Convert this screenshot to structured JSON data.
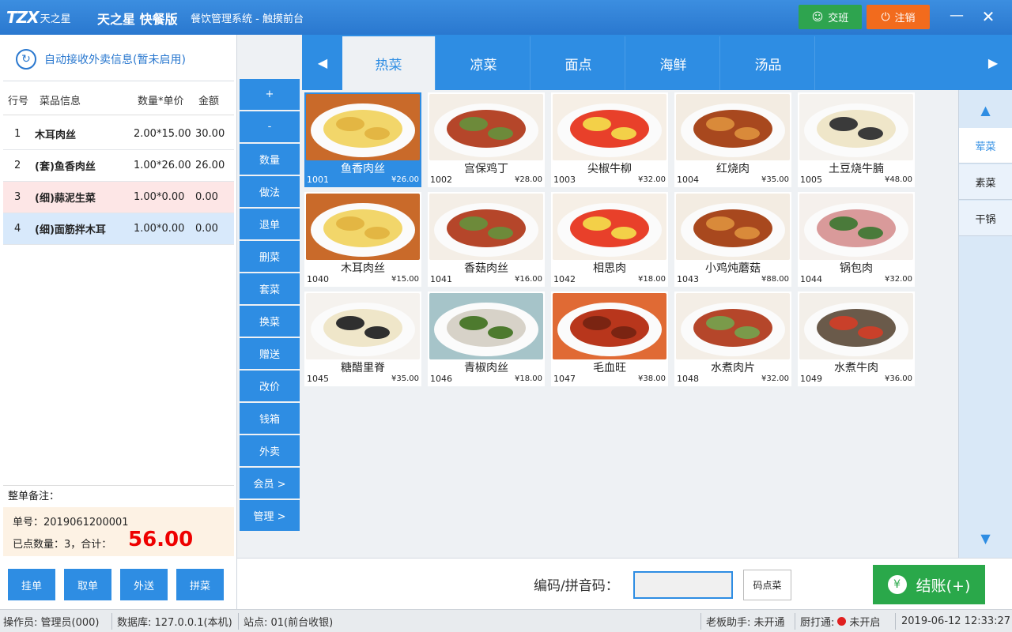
{
  "titlebar": {
    "logo_mark": "TZX",
    "logo_text": "天之星",
    "app_name": "天之星 快餐版",
    "subtitle": "餐饮管理系统 - 触摸前台",
    "shift_label": "交班",
    "logout_label": "注销",
    "minimize": "—",
    "close": "✕"
  },
  "left": {
    "auto_recv": "自动接收外卖信息(暂未启用)",
    "headers": {
      "no": "行号",
      "info": "菜品信息",
      "qty_price": "数量*单价",
      "amount": "金额"
    },
    "rows": [
      {
        "no": "1",
        "name": "木耳肉丝",
        "qty_price": "2.00*15.00",
        "amount": "30.00",
        "bg": "#ffffff"
      },
      {
        "no": "2",
        "name": "(套)鱼香肉丝",
        "qty_price": "1.00*26.00",
        "amount": "26.00",
        "bg": "#ffffff"
      },
      {
        "no": "3",
        "name": "(细)蒜泥生菜",
        "qty_price": "1.00*0.00",
        "amount": "0.00",
        "bg": "#fde6e6"
      },
      {
        "no": "4",
        "name": "(细)面筋拌木耳",
        "qty_price": "1.00*0.00",
        "amount": "0.00",
        "bg": "#d8e9fb"
      }
    ],
    "remark_label": "整单备注：",
    "order_no": "单号：2019061200001",
    "count_line": "已点数量：3，合计：",
    "total": "56.00",
    "buttons": [
      "挂单",
      "取单",
      "外送",
      "拼菜"
    ]
  },
  "actions": [
    "+",
    "-",
    "数量",
    "做法",
    "退单",
    "删菜",
    "套菜",
    "换菜",
    "赠送",
    "改价",
    "钱箱",
    "外卖",
    "会员 >",
    "管理 >"
  ],
  "tabs": [
    "热菜",
    "凉菜",
    "面点",
    "海鲜",
    "汤品"
  ],
  "tab_arrows": {
    "left": "◀",
    "right": "▶"
  },
  "dishes": [
    {
      "name": "鱼香肉丝",
      "code": "1001",
      "price": "¥26.00",
      "selected": true,
      "colors": [
        "#f2d66a",
        "#e3b643",
        "#c96a2a"
      ]
    },
    {
      "name": "宫保鸡丁",
      "code": "1002",
      "price": "¥28.00",
      "selected": false,
      "colors": [
        "#b5462a",
        "#6d8a3a",
        "#f4eee6"
      ]
    },
    {
      "name": "尖椒牛柳",
      "code": "1003",
      "price": "¥32.00",
      "selected": false,
      "colors": [
        "#e8402a",
        "#f3d048",
        "#f6efe6"
      ]
    },
    {
      "name": "红烧肉",
      "code": "1004",
      "price": "¥35.00",
      "selected": false,
      "colors": [
        "#a8481e",
        "#d98a3a",
        "#f3ece2"
      ]
    },
    {
      "name": "土豆烧牛腩",
      "code": "1005",
      "price": "¥48.00",
      "selected": false,
      "colors": [
        "#efe6c9",
        "#3a3a3a",
        "#f5f2ee"
      ]
    },
    {
      "name": "木耳肉丝",
      "code": "1040",
      "price": "¥15.00",
      "selected": false,
      "colors": [
        "#f2d66a",
        "#e3b643",
        "#c96a2a"
      ]
    },
    {
      "name": "香菇肉丝",
      "code": "1041",
      "price": "¥16.00",
      "selected": false,
      "colors": [
        "#b5462a",
        "#6d8a3a",
        "#f4eee6"
      ]
    },
    {
      "name": "相思肉",
      "code": "1042",
      "price": "¥18.00",
      "selected": false,
      "colors": [
        "#e8402a",
        "#f3d048",
        "#f6efe6"
      ]
    },
    {
      "name": "小鸡炖蘑菇",
      "code": "1043",
      "price": "¥88.00",
      "selected": false,
      "colors": [
        "#a8481e",
        "#d98a3a",
        "#f3ece2"
      ]
    },
    {
      "name": "锅包肉",
      "code": "1044",
      "price": "¥32.00",
      "selected": false,
      "colors": [
        "#d99a9a",
        "#4a7a3a",
        "#f5f0ec"
      ]
    },
    {
      "name": "糖醋里脊",
      "code": "1045",
      "price": "¥35.00",
      "selected": false,
      "colors": [
        "#efe6c9",
        "#2f2f2f",
        "#f5f2ee"
      ]
    },
    {
      "name": "青椒肉丝",
      "code": "1046",
      "price": "¥18.00",
      "selected": false,
      "colors": [
        "#d7d2c8",
        "#4d7a2e",
        "#a6c4c9"
      ]
    },
    {
      "name": "毛血旺",
      "code": "1047",
      "price": "¥38.00",
      "selected": false,
      "colors": [
        "#b8361c",
        "#7a2412",
        "#e06a34"
      ]
    },
    {
      "name": "水煮肉片",
      "code": "1048",
      "price": "¥32.00",
      "selected": false,
      "colors": [
        "#b5462a",
        "#7a9a4a",
        "#f4eee6"
      ]
    },
    {
      "name": "水煮牛肉",
      "code": "1049",
      "price": "¥36.00",
      "selected": false,
      "colors": [
        "#6a5a4a",
        "#c9402a",
        "#f3efe9"
      ]
    }
  ],
  "categories": [
    "荤菜",
    "素菜",
    "干锅"
  ],
  "cat_arrows": {
    "up": "▲",
    "down": "▼"
  },
  "bottom": {
    "code_label": "编码/拼音码：",
    "code_value": "",
    "code_btn": "码点菜",
    "pay_btn": "结账(+)",
    "pay_icon": "¥"
  },
  "status": {
    "operator": "操作员: 管理员(000)",
    "database": "数据库: 127.0.0.1(本机)",
    "site": "站点: 01(前台收银)",
    "boss": "老板助手: 未开通",
    "kitchen_label": "厨打通:",
    "kitchen_state": "未开启",
    "datetime": "2019-06-12 12:33:27"
  },
  "colors": {
    "primary": "#2e8de3",
    "pay": "#2aa84a",
    "logout": "#f26b1d",
    "shift": "#2ea44f",
    "total": "#e00000"
  }
}
